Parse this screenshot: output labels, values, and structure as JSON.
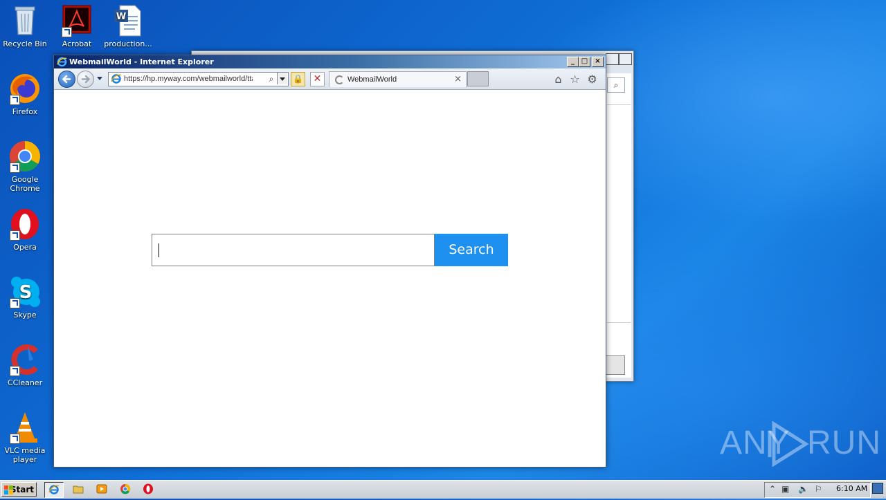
{
  "desktop": {
    "icons": [
      {
        "id": "recycle-bin",
        "label": "Recycle Bin"
      },
      {
        "id": "acrobat",
        "label": "Acrobat Reader DC"
      },
      {
        "id": "production",
        "label": "production..."
      },
      {
        "id": "firefox",
        "label": "Firefox"
      },
      {
        "id": "chrome",
        "label": "Google Chrome"
      },
      {
        "id": "opera",
        "label": "Opera"
      },
      {
        "id": "skype",
        "label": "Skype"
      },
      {
        "id": "ccleaner",
        "label": "CCleaner"
      },
      {
        "id": "vlc",
        "label": "VLC media player"
      }
    ]
  },
  "ie_window": {
    "title": "WebmailWorld - Internet Explorer",
    "address_url": "https://hp.myway.com/webmailworld/ttab",
    "tab_title": "WebmailWorld",
    "tab_close": "×",
    "min_label": "_",
    "max_label": "□",
    "close_label": "×"
  },
  "page": {
    "search_placeholder": "",
    "search_button": "Search"
  },
  "watermark": {
    "left": "ANY",
    "right": "RUN"
  },
  "taskbar": {
    "start_label": "Start",
    "clock": "6:10 AM"
  },
  "colors": {
    "search_button": "#1e90f0",
    "titlebar_start": "#0a246a",
    "desktop": "#0f6fd6"
  }
}
